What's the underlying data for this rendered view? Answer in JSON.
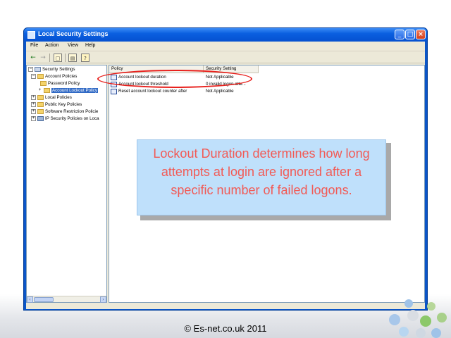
{
  "window": {
    "title": "Local Security Settings",
    "controls": {
      "minimize": "_",
      "maximize": "□",
      "close": "×"
    }
  },
  "menu": {
    "items": [
      "File",
      "Action",
      "View",
      "Help"
    ]
  },
  "toolbar": {
    "back_icon": "back-arrow-icon",
    "forward_icon": "forward-arrow-icon",
    "up_icon": "up-folder-icon",
    "export_icon": "export-list-icon",
    "help_icon": "help-icon"
  },
  "tree": {
    "items": [
      {
        "label": "Security Settings",
        "expander": "−"
      },
      {
        "label": "Account Policies",
        "expander": "−"
      },
      {
        "label": "Password Policy",
        "expander": ""
      },
      {
        "label": "Account Lockout Policy",
        "expander": "+"
      },
      {
        "label": "Local Policies",
        "expander": "+"
      },
      {
        "label": "Public Key Policies",
        "expander": "+"
      },
      {
        "label": "Software Restriction Policie",
        "expander": "+"
      },
      {
        "label": "IP Security Policies on Loca",
        "expander": "+"
      }
    ],
    "selected": "Account Lockout Policy",
    "scroll_left": "‹",
    "scroll_right": "›"
  },
  "list": {
    "columns": [
      "Policy",
      "Security Setting"
    ],
    "rows": [
      {
        "policy": "Account lockout duration",
        "setting": "Not Applicable"
      },
      {
        "policy": "Account lockout threshold",
        "setting": "0 invalid logon atte..."
      },
      {
        "policy": "Reset account lockout counter after",
        "setting": "Not Applicable"
      }
    ]
  },
  "callout": {
    "text": "Lockout Duration determines how long attempts at login are ignored after a specific number of failed logons."
  },
  "footer": {
    "text": "© Es-net.co.uk 2011"
  },
  "colors": {
    "titlebar": "#0a5fe0",
    "callout_bg": "#bfe0fb",
    "callout_text": "#f25a55",
    "annotation": "#e8201c",
    "selection": "#316ac5"
  }
}
